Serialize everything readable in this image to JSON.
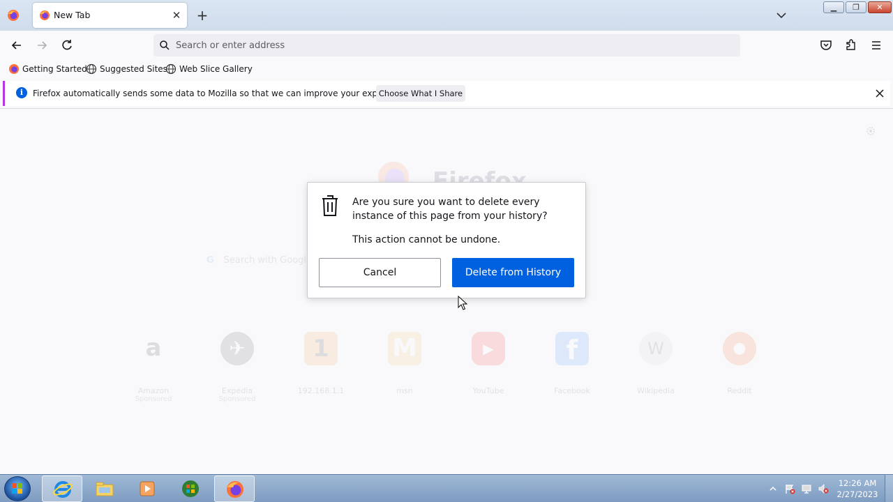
{
  "browser": {
    "tab": {
      "title": "New Tab"
    },
    "urlbar": {
      "placeholder": "Search or enter address"
    },
    "bookmarks": [
      "Getting Started",
      "Suggested Sites",
      "Web Slice Gallery"
    ]
  },
  "notification": {
    "message": "Firefox automatically sends some data to Mozilla so that we can improve your experience.",
    "button": "Choose What I Share"
  },
  "newtab": {
    "logo_text": "Firefox",
    "search_placeholder": "Search with Google or enter address",
    "top_sites": [
      {
        "label": "Amazon",
        "sub": "Sponsored",
        "color": "#ff9900",
        "glyph": "a"
      },
      {
        "label": "Expedia",
        "sub": "Sponsored",
        "color": "#555555",
        "glyph": "✈"
      },
      {
        "label": "192.168.1.1",
        "sub": "",
        "color": "#f7931e",
        "glyph": "1"
      },
      {
        "label": "msn",
        "sub": "",
        "color": "#f2b134",
        "glyph": "M"
      },
      {
        "label": "YouTube",
        "sub": "",
        "color": "#ff0000",
        "glyph": "▶"
      },
      {
        "label": "Facebook",
        "sub": "",
        "color": "#1877f2",
        "glyph": "f"
      },
      {
        "label": "Wikipedia",
        "sub": "",
        "color": "#888888",
        "glyph": "W"
      },
      {
        "label": "Reddit",
        "sub": "",
        "color": "#ff4500",
        "glyph": "●"
      }
    ]
  },
  "dialog": {
    "question": "Are you sure you want to delete every instance of this page from your history?",
    "warning": "This action cannot be undone.",
    "cancel_label": "Cancel",
    "delete_label": "Delete from History",
    "accent_color": "#0061e0"
  },
  "taskbar": {
    "time": "12:26 AM",
    "date": "2/27/2023"
  }
}
